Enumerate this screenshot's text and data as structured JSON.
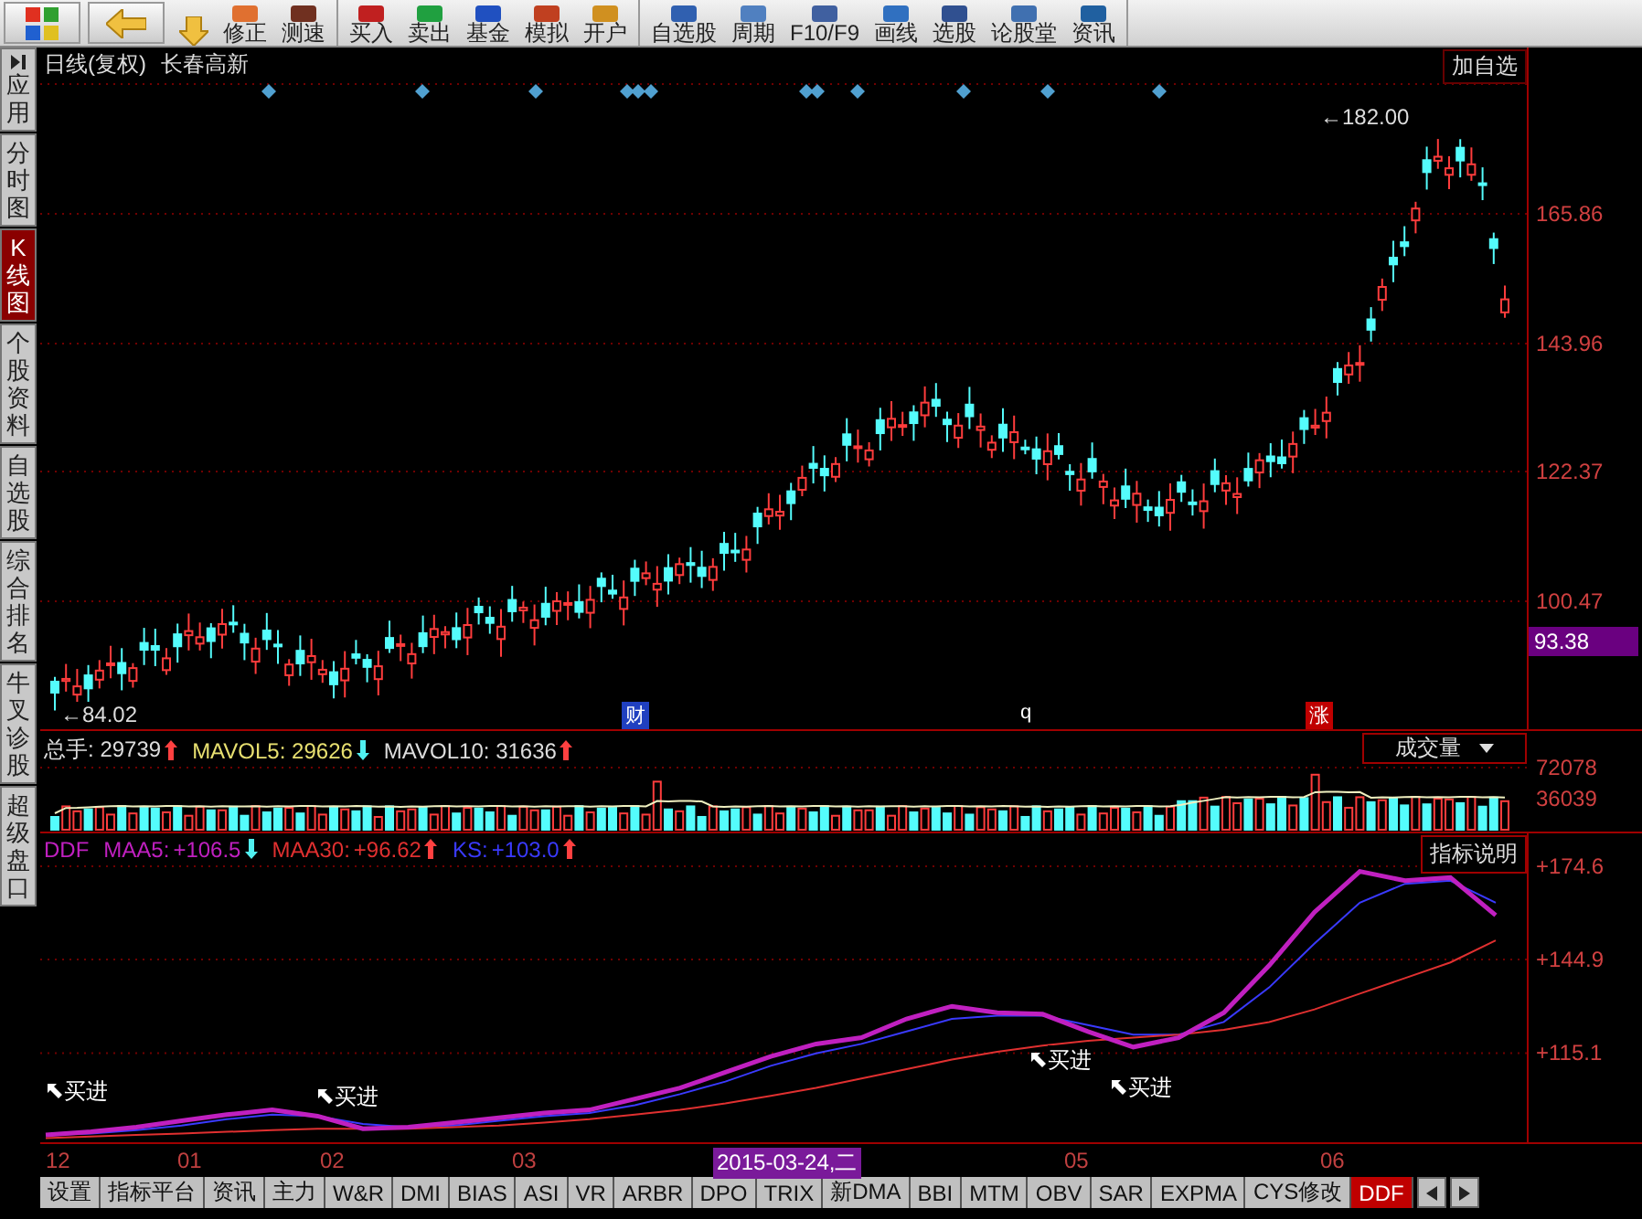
{
  "toolbar": {
    "groups": [
      [
        "修正",
        "测速"
      ],
      [
        "买入",
        "卖出",
        "基金",
        "模拟",
        "开户"
      ],
      [
        "自选股",
        "周期",
        "F10/F9",
        "画线",
        "选股",
        "论股堂",
        "资讯"
      ]
    ]
  },
  "sidebar": {
    "items": [
      {
        "label": "应用",
        "kind": "collapse",
        "selected": false
      },
      {
        "label": "分时图",
        "kind": "page",
        "selected": false
      },
      {
        "label": "K线图",
        "kind": "page",
        "selected": true
      },
      {
        "label": "个股资料",
        "kind": "page",
        "selected": false
      },
      {
        "label": "自选股",
        "kind": "page",
        "selected": false
      },
      {
        "label": "综合排名",
        "kind": "page",
        "selected": false
      },
      {
        "label": "牛叉诊股",
        "kind": "page",
        "selected": false
      },
      {
        "label": "超级盘口",
        "kind": "page",
        "selected": false
      }
    ]
  },
  "price_panel": {
    "title": "日线(复权)",
    "stock": "长春高新",
    "add_button": "加自选",
    "high_label": "←182.00",
    "low_label": "←84.02",
    "axis_labels": [
      "165.86",
      "143.96",
      "122.37",
      "100.47"
    ],
    "current_price": "93.38",
    "markers": [
      {
        "label": "财",
        "color": "#2040c0"
      },
      {
        "label": "q",
        "color": "#000000"
      },
      {
        "label": "涨",
        "color": "#c00000"
      }
    ]
  },
  "volume_panel": {
    "stats": [
      {
        "label": "总手:",
        "value": "29739",
        "up": true
      },
      {
        "label": "MAVOL5:",
        "value": "29626",
        "up": false
      },
      {
        "label": "MAVOL10:",
        "value": "31636",
        "up": true
      }
    ],
    "selector": "成交量",
    "axis_labels": [
      "72078",
      "36039"
    ]
  },
  "indicator_panel": {
    "name": "DDF",
    "lines": [
      {
        "value": "+106.5",
        "up": false
      },
      {
        "value": "+96.62",
        "up": true
      },
      {
        "value": "+103.0",
        "up": true
      }
    ],
    "help_button": "指标说明",
    "signals": [
      "买进",
      "买进",
      "买进",
      "买进"
    ],
    "chart_data": {
      "type": "line",
      "categories": [
        null,
        null,
        null,
        null,
        null,
        null,
        null,
        null,
        null,
        null,
        null,
        null,
        null,
        null,
        null,
        null,
        null,
        null,
        null,
        null,
        null,
        null,
        null,
        null,
        null,
        null,
        null,
        null,
        null,
        null,
        null,
        null,
        null
      ],
      "ylim": [
        86.1,
        185.1
      ],
      "grid": true,
      "yticks": [
        {
          "value": 174.6,
          "label": "+174.6"
        },
        {
          "value": 144.9,
          "label": "+144.9"
        },
        {
          "value": 115.1,
          "label": "+115.1"
        }
      ],
      "series": [
        {
          "name": "MAA5:",
          "color": "#c020c0",
          "values": [
            89,
            90,
            91.5,
            93.5,
            95.5,
            97,
            95,
            91,
            91.5,
            93,
            94.5,
            96,
            97,
            100.5,
            104,
            109,
            114,
            118,
            120,
            126,
            130,
            128,
            127.5,
            122,
            117,
            120,
            128,
            143,
            160,
            173,
            170,
            171,
            159
          ]
        },
        {
          "name": "MAA30:",
          "color": "#e03030",
          "values": [
            88,
            88.5,
            89,
            89.5,
            90,
            90.5,
            91,
            91,
            91,
            91.5,
            92,
            93,
            94,
            95.5,
            97,
            99,
            101.5,
            104,
            107,
            110,
            113,
            115.5,
            117.5,
            119,
            120,
            121,
            122.5,
            125,
            129,
            134,
            139,
            144,
            151
          ]
        },
        {
          "name": "KS:",
          "color": "#3a3aff",
          "values": [
            89,
            89.5,
            90.5,
            92,
            94,
            95.5,
            95,
            92.5,
            91.5,
            92,
            93.5,
            95,
            96,
            98.5,
            102,
            106,
            111,
            115,
            118,
            122,
            126,
            127,
            127,
            124,
            121,
            121,
            125,
            136,
            150,
            163,
            169,
            170,
            163
          ]
        }
      ]
    }
  },
  "date_axis": [
    {
      "label": "12",
      "selected": false
    },
    {
      "label": "01",
      "selected": false
    },
    {
      "label": "02",
      "selected": false
    },
    {
      "label": "03",
      "selected": false
    },
    {
      "label": "2015-03-24,二",
      "selected": true
    },
    {
      "label": "05",
      "selected": false
    },
    {
      "label": "06",
      "selected": false
    }
  ],
  "tabs": [
    {
      "label": "设置",
      "selected": false
    },
    {
      "label": "指标平台",
      "selected": false
    },
    {
      "label": "资讯",
      "selected": false
    },
    {
      "label": "主力",
      "selected": false
    },
    {
      "label": "W&R",
      "selected": false
    },
    {
      "label": "DMI",
      "selected": false
    },
    {
      "label": "BIAS",
      "selected": false
    },
    {
      "label": "ASI",
      "selected": false
    },
    {
      "label": "VR",
      "selected": false
    },
    {
      "label": "ARBR",
      "selected": false
    },
    {
      "label": "DPO",
      "selected": false
    },
    {
      "label": "TRIX",
      "selected": false
    },
    {
      "label": "新DMA",
      "selected": false
    },
    {
      "label": "BBI",
      "selected": false
    },
    {
      "label": "MTM",
      "selected": false
    },
    {
      "label": "OBV",
      "selected": false
    },
    {
      "label": "SAR",
      "selected": false
    },
    {
      "label": "EXPMA",
      "selected": false
    },
    {
      "label": "CYS修改",
      "selected": false
    },
    {
      "label": "DDF",
      "selected": true
    }
  ]
}
